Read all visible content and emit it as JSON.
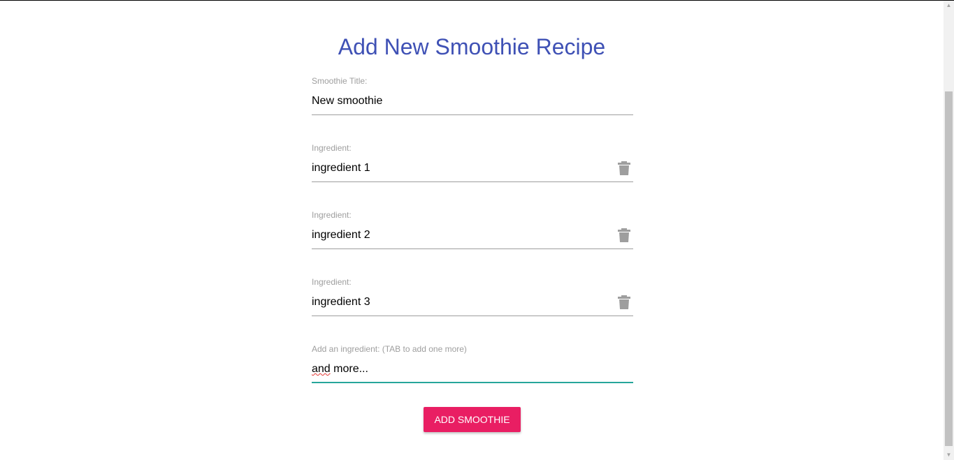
{
  "form": {
    "title": "Add New Smoothie Recipe",
    "title_field": {
      "label": "Smoothie Title:",
      "value": "New smoothie"
    },
    "ingredients": [
      {
        "label": "Ingredient:",
        "value": "ingredient 1",
        "icon": "trash-icon"
      },
      {
        "label": "Ingredient:",
        "value": "ingredient 2",
        "icon": "trash-icon"
      },
      {
        "label": "Ingredient:",
        "value": "ingredient 3",
        "icon": "trash-icon"
      }
    ],
    "add_ingredient": {
      "label": "Add an ingredient: (TAB to add one more)",
      "value_word1": "and",
      "value_rest": " more..."
    },
    "submit_label": "ADD SMOOTHIE"
  },
  "colors": {
    "title": "#3f51b5",
    "button": "#e91e63",
    "active_underline": "#26a69a",
    "icon": "#9e9e9e"
  }
}
